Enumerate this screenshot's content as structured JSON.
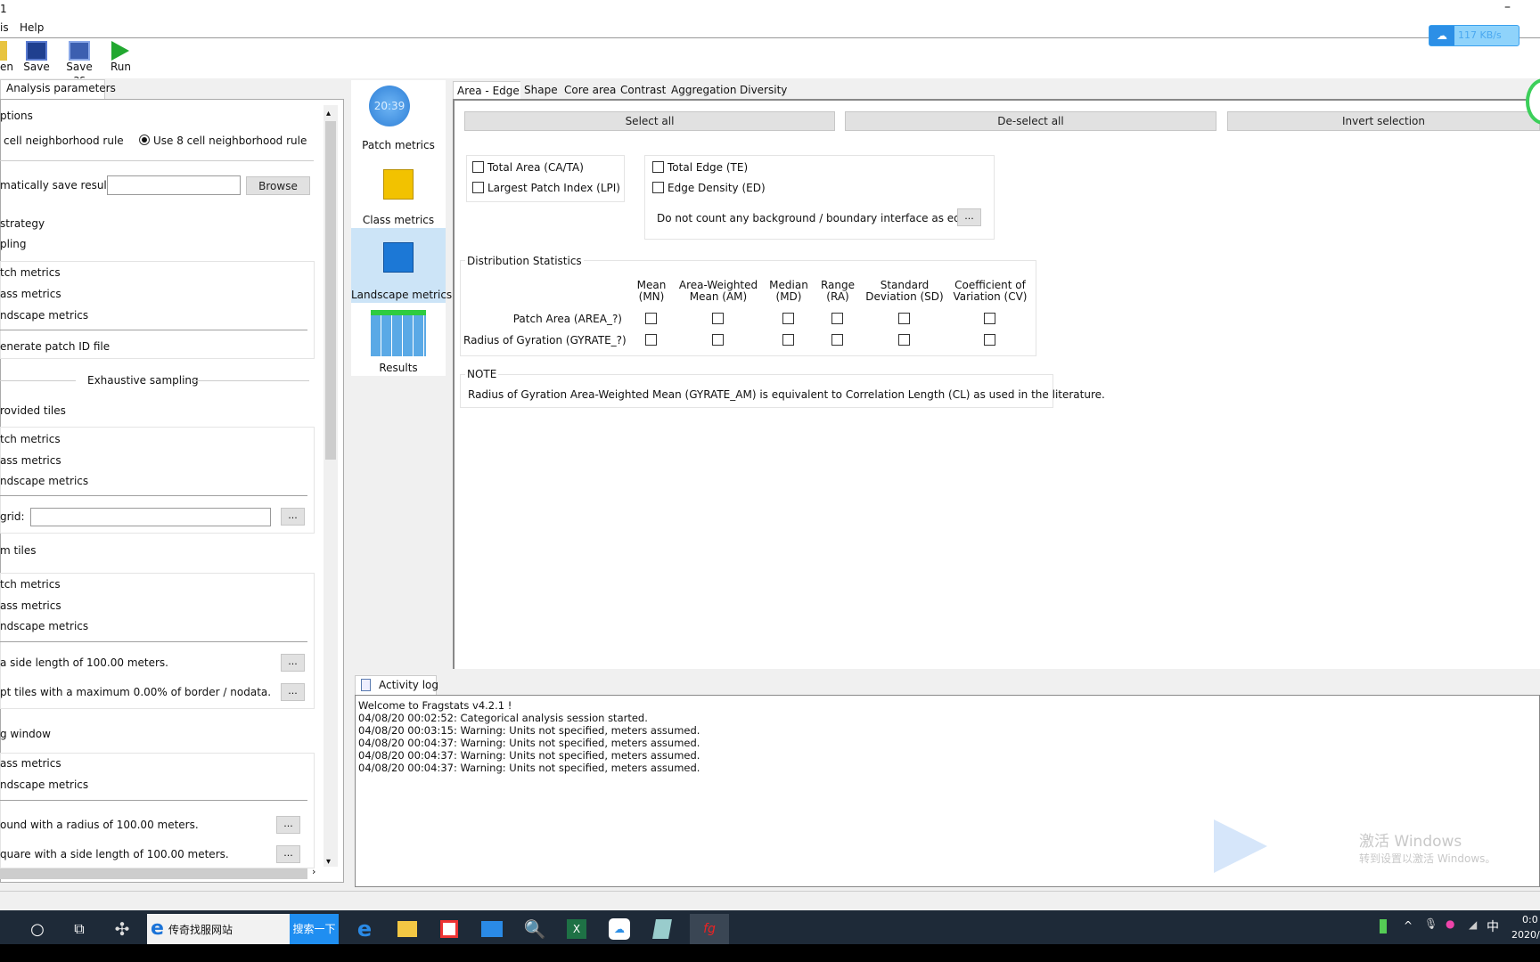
{
  "window": {
    "title_fragment": "1",
    "minimize": "–"
  },
  "menu": [
    "is",
    "Help"
  ],
  "toolbar": [
    {
      "label": "en",
      "icon": "open-folder-icon"
    },
    {
      "label": "Save",
      "icon": "save-icon"
    },
    {
      "label": "Save as",
      "icon": "save-as-icon"
    },
    {
      "label": "Run",
      "icon": "play-icon"
    }
  ],
  "net_widget": {
    "speed": "117 KB/s"
  },
  "left": {
    "tab": "Analysis parameters",
    "options": "ptions",
    "rule4": "cell neighborhood rule",
    "rule8": "Use 8 cell neighborhood rule",
    "autosave": "matically save results",
    "autosave_value": "",
    "browse": "Browse",
    "strategy": "strategy",
    "sampling": "pling",
    "s1": [
      "tch metrics",
      "ass metrics",
      "ndscape metrics"
    ],
    "generate": "enerate patch ID file",
    "exhaustive": "Exhaustive sampling",
    "provided": "rovided tiles",
    "s2": [
      "tch metrics",
      "ass metrics",
      "ndscape metrics"
    ],
    "grid": "grid:",
    "grid_value": "",
    "mtiles": "m tiles",
    "s3": [
      "tch metrics",
      "ass metrics",
      "ndscape metrics"
    ],
    "side": "a side length of 100.00 meters.",
    "accept": "pt tiles with a maximum 0.00% of border / nodata.",
    "window": "g window",
    "s4": [
      "ass metrics",
      "ndscape metrics"
    ],
    "round": "ound with a radius of 100.00 meters.",
    "square": "quare with a side length of 100.00 meters.",
    "dots": "..."
  },
  "nav": [
    {
      "label": "Patch metrics",
      "clock": "20:39"
    },
    {
      "label": "Class metrics"
    },
    {
      "label": "Landscape metrics",
      "selected": true
    },
    {
      "label": "Results"
    }
  ],
  "tabs": [
    "Area - Edge",
    "Shape",
    "Core area",
    "Contrast",
    "Aggregation",
    "Diversity"
  ],
  "actions": [
    "Select all",
    "De-select all",
    "Invert selection"
  ],
  "metrics": {
    "area": [
      "Total Area  (CA/TA)",
      "Largest Patch Index  (LPI)"
    ],
    "edge": [
      "Total Edge  (TE)",
      "Edge Density  (ED)"
    ],
    "edge_note": "Do not count any background / boundary interface as edge.",
    "dist_title": "Distribution Statistics",
    "columns": [
      [
        "Mean",
        "(MN)"
      ],
      [
        "Area-Weighted",
        "Mean (AM)"
      ],
      [
        "Median",
        "(MD)"
      ],
      [
        "Range",
        "(RA)"
      ],
      [
        "Standard",
        "Deviation (SD)"
      ],
      [
        "Coefficient of",
        "Variation (CV)"
      ]
    ],
    "rows": [
      "Patch Area (AREA_?)",
      "Radius of Gyration (GYRATE_?)"
    ],
    "note_title": "NOTE",
    "note": "Radius of Gyration Area-Weighted Mean (GYRATE_AM) is equivalent to Correlation Length (CL) as used in the literature."
  },
  "log": {
    "tab": "Activity log",
    "lines": [
      "Welcome to Fragstats v4.2.1 !",
      "04/08/20 00:02:52: Categorical analysis session started.",
      "04/08/20 00:03:15: Warning: Units not specified, meters assumed.",
      "04/08/20 00:04:37: Warning: Units not specified, meters assumed.",
      "04/08/20 00:04:37: Warning: Units not specified, meters assumed.",
      "04/08/20 00:04:37: Warning: Units not specified, meters assumed."
    ]
  },
  "watermark": [
    "激活 Windows",
    "转到设置以激活 Windows。"
  ],
  "taskbar": {
    "search_text": "传奇找服网站",
    "search_button": "搜索一下",
    "tray_lang": "中",
    "time": "0:0",
    "date": "2020/"
  },
  "colors": {
    "accent": "#3c8fd8",
    "taskbar": "#1e2a38",
    "selected_nav": "#cce4f7"
  }
}
